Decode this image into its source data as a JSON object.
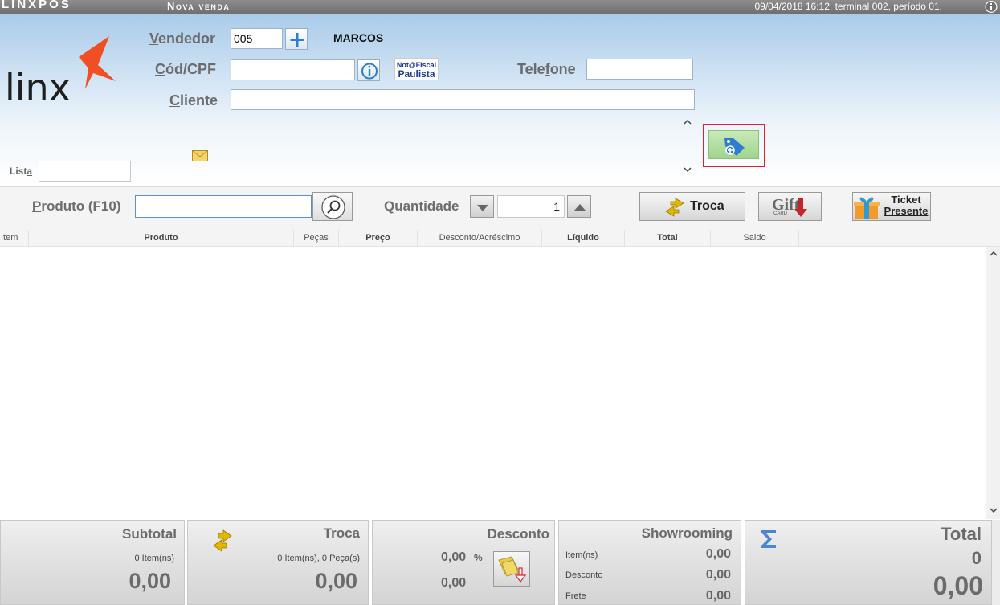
{
  "titlebar": {
    "app_name": "LINXPOS",
    "window_title": "Nova venda",
    "status": "09/04/2018 16:12, terminal 002, período 01.",
    "info_icon": "info-circle-icon"
  },
  "brand": {
    "logo_text": "linx",
    "accent_color": "#f04e23"
  },
  "header": {
    "seller_label_u": "V",
    "seller_label_rest": "endedor",
    "seller_value": "005",
    "seller_name": "MARCOS",
    "cpf_label_u": "C",
    "cpf_label_rest": "ód/CPF",
    "cpf_value": "",
    "nota_fiscal_top": "Not@Fiscal",
    "nota_fiscal_bottom": "Paulista",
    "phone_label_pre": "Tele",
    "phone_label_u": "f",
    "phone_label_rest": "one",
    "phone_value": "",
    "client_label_u": "C",
    "client_label_rest": "liente",
    "client_value": "",
    "list_label_pre": "List",
    "list_label_u": "a",
    "list_value": "",
    "highlight_color": "#d9232a"
  },
  "product_bar": {
    "product_label_u": "P",
    "product_label_rest": "roduto (F10)",
    "product_value": "",
    "quantity_label": "Quantidade",
    "quantity_value": "1",
    "troca_u": "T",
    "troca_rest": "roca",
    "gift_text": "Gift",
    "gift_sub": "CARD",
    "ticket_line1": "Ticket",
    "ticket_line2": "Presente"
  },
  "grid": {
    "columns": [
      "Item",
      "Produto",
      "Peças",
      "Preço",
      "Desconto/Acréscimo",
      "Líquido",
      "Total",
      "Saldo"
    ]
  },
  "footer": {
    "subtotal": {
      "title": "Subtotal",
      "items": "0 Item(ns)",
      "value": "0,00"
    },
    "troca": {
      "title": "Troca",
      "items": "0 Item(ns), 0 Peça(s)",
      "value": "0,00"
    },
    "desconto": {
      "title": "Desconto",
      "percent_value": "0,00",
      "percent_sign": "%",
      "value": "0,00"
    },
    "showrooming": {
      "title": "Showrooming",
      "rows": [
        {
          "label": "Item(ns)",
          "value": "0,00"
        },
        {
          "label": "Desconto",
          "value": "0,00"
        },
        {
          "label": "Frete",
          "value": "0,00"
        }
      ]
    },
    "total": {
      "title": "Total",
      "count": "0",
      "value": "0,00"
    }
  }
}
